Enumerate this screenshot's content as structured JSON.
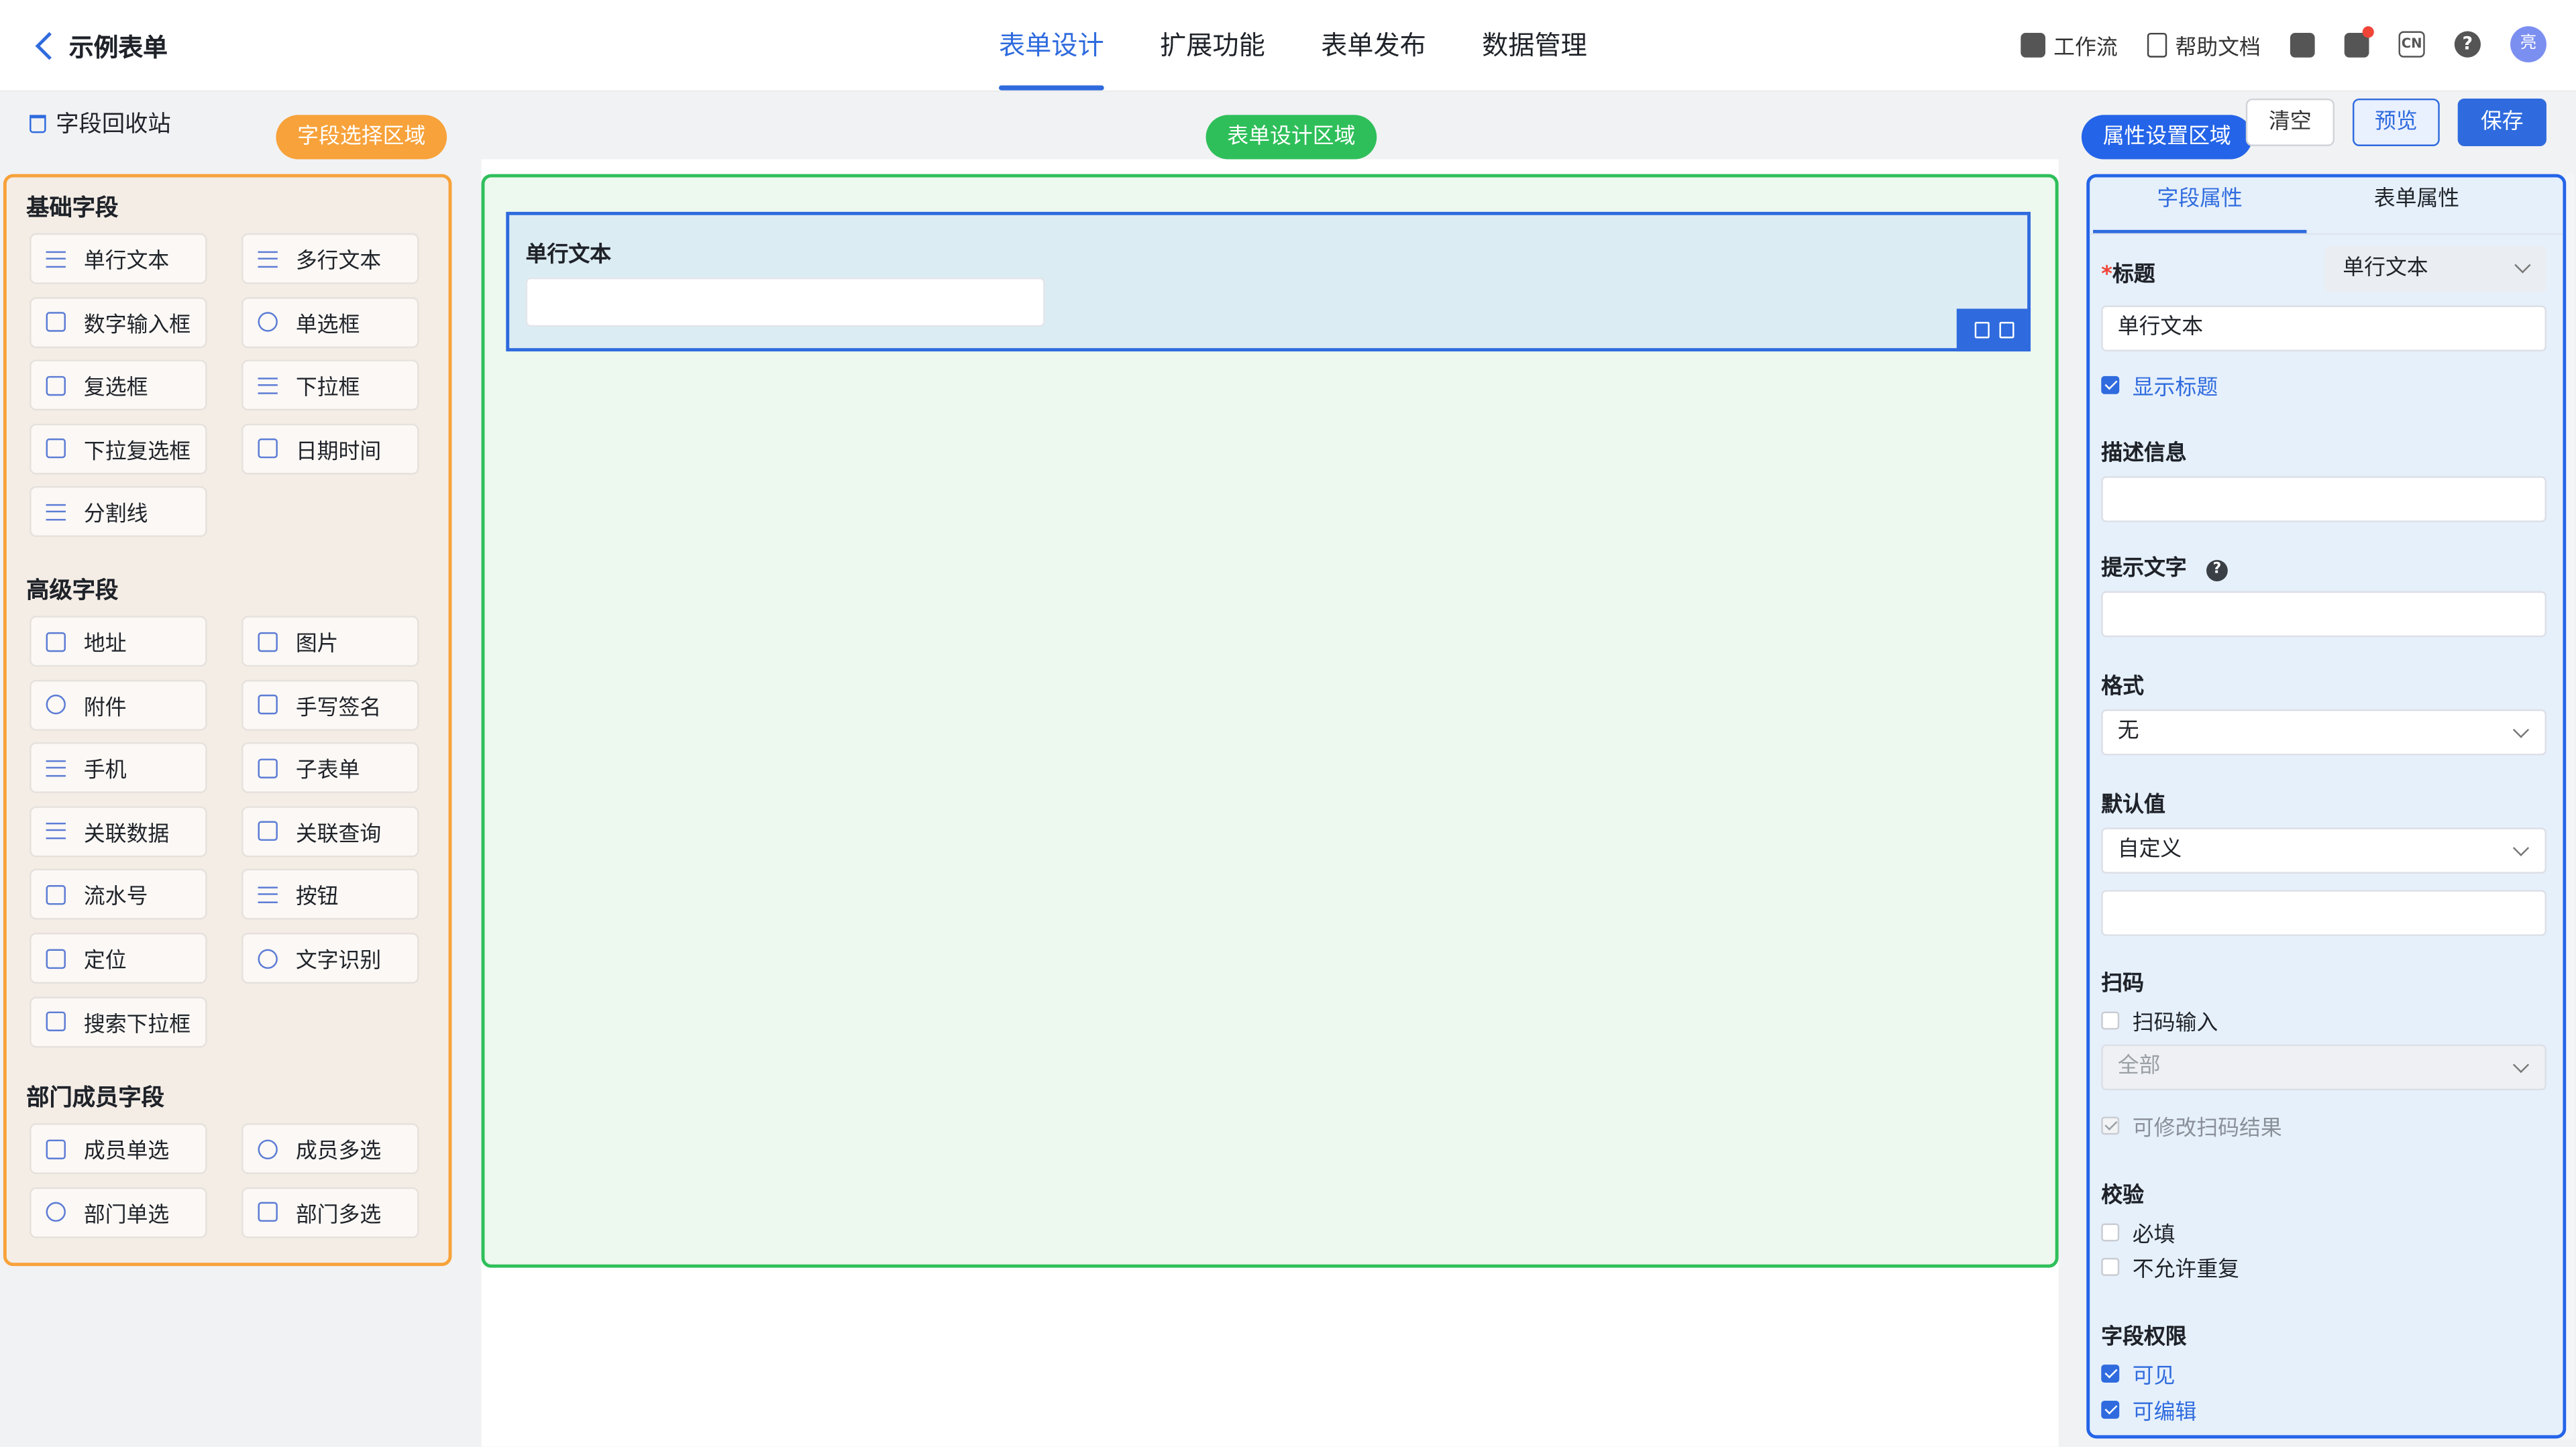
{
  "header": {
    "back_title": "示例表单",
    "tabs": [
      "表单设计",
      "扩展功能",
      "表单发布",
      "数据管理"
    ],
    "tools": {
      "workflow": "工作流",
      "help_docs": "帮助文档",
      "avatar_text": "亮",
      "lang": "CN"
    }
  },
  "subheader": {
    "recycle": "字段回收站",
    "field_area_tag": "字段选择区域",
    "design_area_tag": "表单设计区域",
    "prop_area_tag": "属性设置区域",
    "clear": "清空",
    "preview": "预览",
    "save": "保存"
  },
  "left": {
    "basic_title": "基础字段",
    "basic": [
      "单行文本",
      "多行文本",
      "数字输入框",
      "单选框",
      "复选框",
      "下拉框",
      "下拉复选框",
      "日期时间",
      "分割线"
    ],
    "advanced_title": "高级字段",
    "advanced": [
      "地址",
      "图片",
      "附件",
      "手写签名",
      "手机",
      "子表单",
      "关联数据",
      "关联查询",
      "流水号",
      "按钮",
      "定位",
      "文字识别",
      "搜索下拉框"
    ],
    "member_title": "部门成员字段",
    "member": [
      "成员单选",
      "成员多选",
      "部门单选",
      "部门多选"
    ]
  },
  "canvas": {
    "field_label": "单行文本"
  },
  "right": {
    "tab_field": "字段属性",
    "tab_form": "表单属性",
    "title_label": "标题",
    "title_type": "单行文本",
    "title_value": "单行文本",
    "show_title": "显示标题",
    "desc_label": "描述信息",
    "hint_label": "提示文字",
    "format_label": "格式",
    "format_value": "无",
    "default_label": "默认值",
    "default_value": "自定义",
    "scan_label": "扫码",
    "scan_input": "扫码输入",
    "scan_scope": "全部",
    "scan_editable": "可修改扫码结果",
    "verify_label": "校验",
    "required": "必填",
    "no_duplicate": "不允许重复",
    "perm_label": "字段权限",
    "visible": "可见",
    "editable": "可编辑"
  }
}
